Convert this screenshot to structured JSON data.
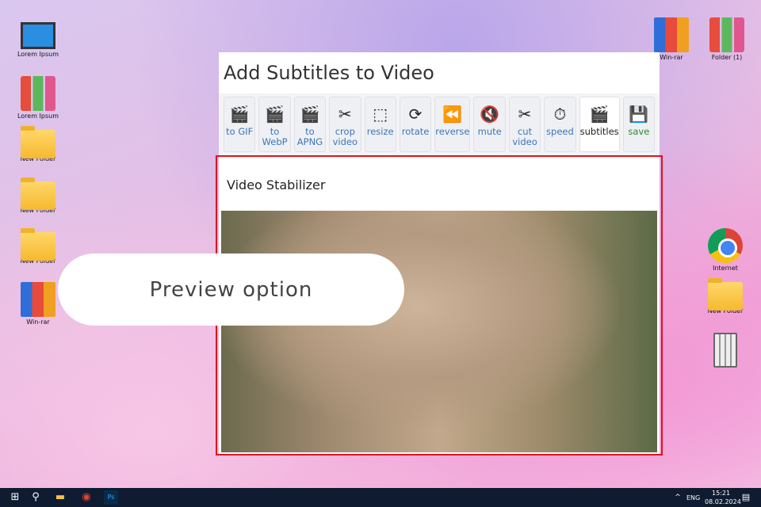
{
  "desktop": {
    "left": [
      {
        "label": "Lorem Ipsum",
        "icon": "monitor"
      },
      {
        "label": "Lorem Ipsum",
        "icon": "binder"
      },
      {
        "label": "New Folder",
        "icon": "folder"
      },
      {
        "label": "New Folder",
        "icon": "folder"
      },
      {
        "label": "New Folder",
        "icon": "folder"
      },
      {
        "label": "Win-rar",
        "icon": "rar"
      }
    ],
    "right": [
      {
        "label": "Win-rar",
        "icon": "rar"
      },
      {
        "label": "Folder (1)",
        "icon": "binder"
      },
      {
        "label": "Internet",
        "icon": "chrome"
      },
      {
        "label": "New Folder",
        "icon": "folder"
      }
    ]
  },
  "window": {
    "title": "Add Subtitles to Video",
    "toolbar": [
      {
        "l1": "to GIF",
        "l2": ""
      },
      {
        "l1": "to",
        "l2": "WebP"
      },
      {
        "l1": "to",
        "l2": "APNG"
      },
      {
        "l1": "crop",
        "l2": "video"
      },
      {
        "l1": "resize",
        "l2": ""
      },
      {
        "l1": "rotate",
        "l2": ""
      },
      {
        "l1": "reverse",
        "l2": ""
      },
      {
        "l1": "mute",
        "l2": ""
      },
      {
        "l1": "cut",
        "l2": "video"
      },
      {
        "l1": "speed",
        "l2": ""
      },
      {
        "l1": "subtitles",
        "l2": ""
      },
      {
        "l1": "save",
        "l2": ""
      }
    ],
    "section_title": "Video Stabilizer"
  },
  "callout": "Preview option",
  "taskbar": {
    "lang": "ENG",
    "time": "15:21",
    "date": "08.02.2024"
  }
}
